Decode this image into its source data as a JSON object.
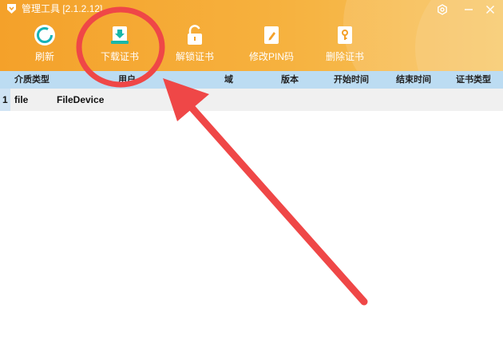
{
  "app": {
    "title": "管理工具 [2.1.2.12]"
  },
  "toolbar": {
    "refresh": "刷新",
    "download_cert": "下载证书",
    "unlock_cert": "解锁证书",
    "modify_pin": "修改PIN码",
    "delete_cert": "删除证书"
  },
  "table": {
    "headers": {
      "media_type": "介质类型",
      "user": "用户",
      "domain": "域",
      "version": "版本",
      "start_time": "开始时间",
      "end_time": "结束时间",
      "cert_type": "证书类型"
    },
    "rows": [
      {
        "index": "1",
        "media_type": "file",
        "user": "FileDevice"
      }
    ]
  },
  "colors": {
    "header_gradient_start": "#f4a12a",
    "header_gradient_end": "#f7c45e",
    "table_header_bg": "#bcdcf2",
    "annotation_red": "#ef4747"
  },
  "icons": {
    "app_logo": "shield-icon",
    "settings": "gear-icon",
    "minimize": "minimize-icon",
    "close": "close-icon",
    "refresh": "refresh-icon",
    "download": "download-cert-icon",
    "unlock": "unlock-icon",
    "pin": "edit-pin-icon",
    "delete": "delete-cert-icon"
  }
}
